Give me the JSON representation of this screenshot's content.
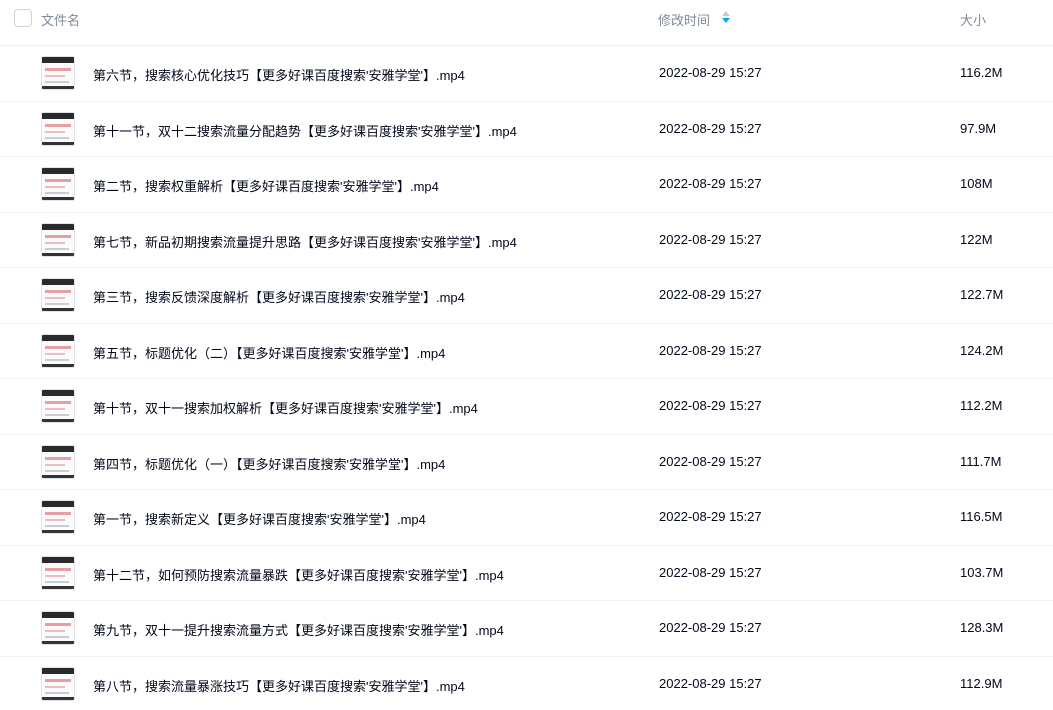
{
  "header": {
    "name_label": "文件名",
    "time_label": "修改时间",
    "size_label": "大小",
    "sort_icon": "sort-icon",
    "accent_color": "#06a7ff"
  },
  "files": [
    {
      "name": "第六节，搜索核心优化技巧【更多好课百度搜索'安雅学堂'】.mp4",
      "time": "2022-08-29 15:27",
      "size": "116.2M"
    },
    {
      "name": "第十一节，双十二搜索流量分配趋势【更多好课百度搜索'安雅学堂'】.mp4",
      "time": "2022-08-29 15:27",
      "size": "97.9M"
    },
    {
      "name": "第二节，搜索权重解析【更多好课百度搜索'安雅学堂'】.mp4",
      "time": "2022-08-29 15:27",
      "size": "108M"
    },
    {
      "name": "第七节，新品初期搜索流量提升思路【更多好课百度搜索'安雅学堂'】.mp4",
      "time": "2022-08-29 15:27",
      "size": "122M"
    },
    {
      "name": "第三节，搜索反馈深度解析【更多好课百度搜索'安雅学堂'】.mp4",
      "time": "2022-08-29 15:27",
      "size": "122.7M"
    },
    {
      "name": "第五节，标题优化（二）【更多好课百度搜索'安雅学堂'】.mp4",
      "time": "2022-08-29 15:27",
      "size": "124.2M"
    },
    {
      "name": "第十节，双十一搜索加权解析【更多好课百度搜索'安雅学堂'】.mp4",
      "time": "2022-08-29 15:27",
      "size": "112.2M"
    },
    {
      "name": "第四节，标题优化（一）【更多好课百度搜索'安雅学堂'】.mp4",
      "time": "2022-08-29 15:27",
      "size": "111.7M"
    },
    {
      "name": "第一节，搜索新定义【更多好课百度搜索'安雅学堂'】.mp4",
      "time": "2022-08-29 15:27",
      "size": "116.5M"
    },
    {
      "name": "第十二节，如何预防搜索流量暴跌【更多好课百度搜索'安雅学堂'】.mp4",
      "time": "2022-08-29 15:27",
      "size": "103.7M"
    },
    {
      "name": "第九节，双十一提升搜索流量方式【更多好课百度搜索'安雅学堂'】.mp4",
      "time": "2022-08-29 15:27",
      "size": "128.3M"
    },
    {
      "name": "第八节，搜索流量暴涨技巧【更多好课百度搜索'安雅学堂'】.mp4",
      "time": "2022-08-29 15:27",
      "size": "112.9M"
    }
  ],
  "row_icons": [
    "video-thumbnail-icon"
  ]
}
